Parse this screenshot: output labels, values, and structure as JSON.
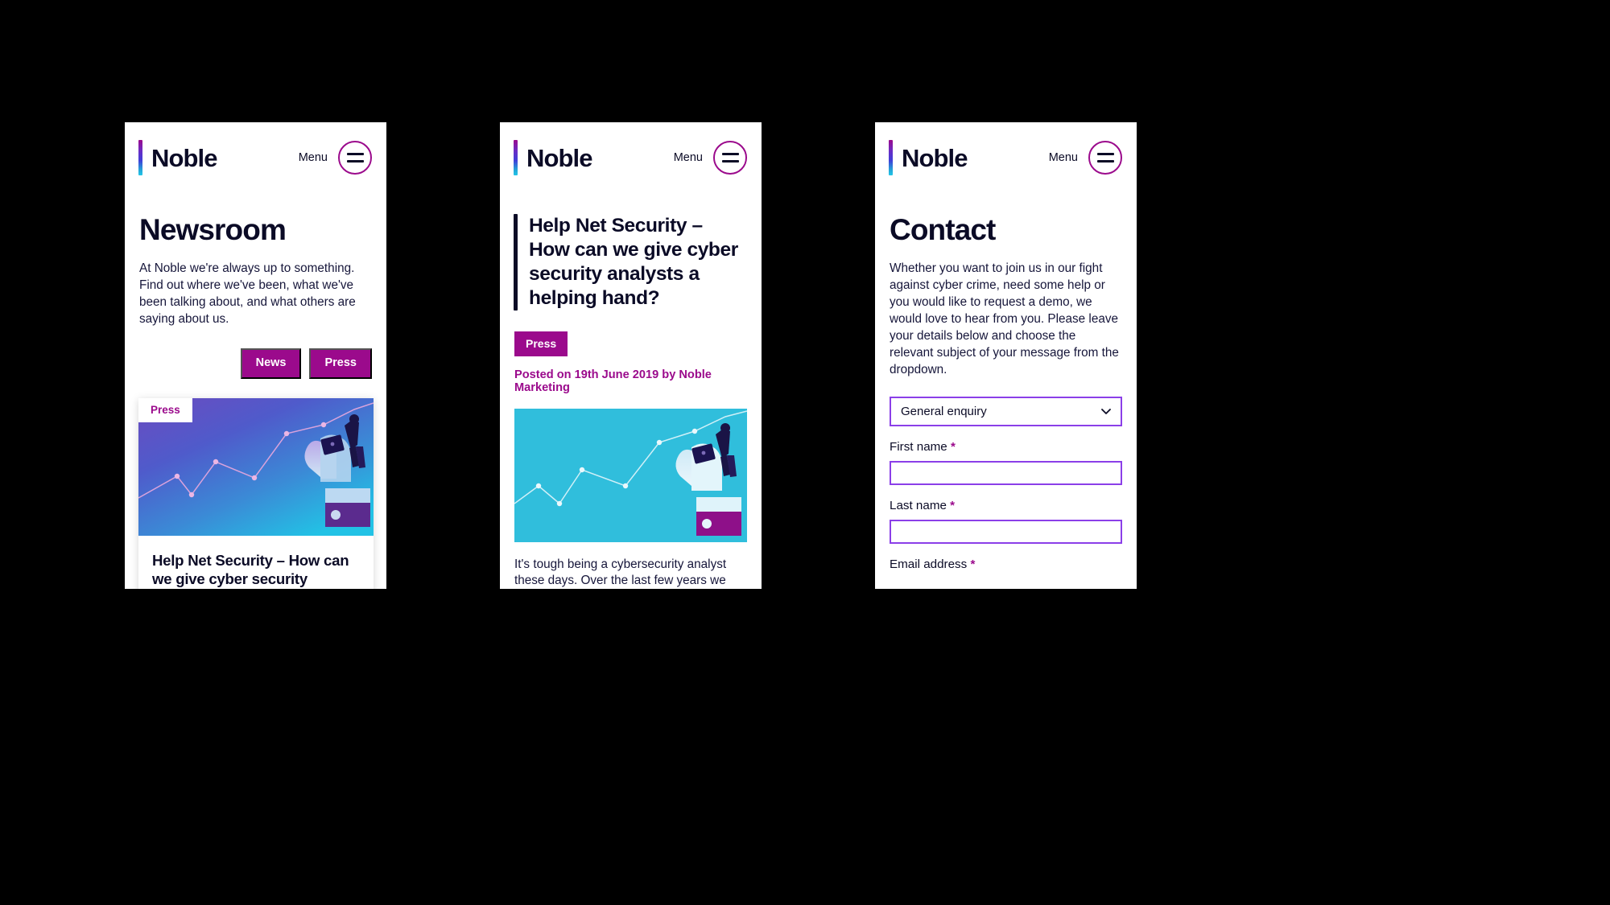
{
  "brand": {
    "name": "Noble",
    "accent_magenta": "#9B0A8C",
    "accent_violet": "#8B3FE8",
    "ink": "#0B0B26"
  },
  "header": {
    "menu_label": "Menu",
    "menu_icon": "hamburger-icon"
  },
  "screens": {
    "newsroom": {
      "title": "Newsroom",
      "intro": "At Noble we're always up to something. Find out where we've been, what we've been talking about, and what others are saying about us.",
      "filters": [
        {
          "label": "News"
        },
        {
          "label": "Press"
        }
      ],
      "card": {
        "badge": "Press",
        "title": "Help Net Security – How can we give cyber security analysts a helping hand?",
        "image_alt": "line-chart-hand-businessman-illustration"
      }
    },
    "article": {
      "title": "Help Net Security – How can we give cyber security analysts a helping hand?",
      "tag": "Press",
      "byline": "Posted on 19th June 2019 by Noble Marketing",
      "body": "It's tough being a cybersecurity analyst these days. Over the last few years we",
      "image_alt": "line-chart-hand-businessman-illustration-cyan"
    },
    "contact": {
      "title": "Contact",
      "intro": "Whether you want to join us in our fight against cyber crime, need some help or you would like to request a demo, we would love to hear from you. Please leave your details below and choose the relevant subject of your message from the dropdown.",
      "subject_select": {
        "value": "General enquiry",
        "icon": "chevron-down-icon"
      },
      "fields": [
        {
          "label": "First name",
          "required": "*",
          "value": ""
        },
        {
          "label": "Last name",
          "required": "*",
          "value": ""
        },
        {
          "label": "Email address",
          "required": "*",
          "value": ""
        }
      ]
    }
  }
}
